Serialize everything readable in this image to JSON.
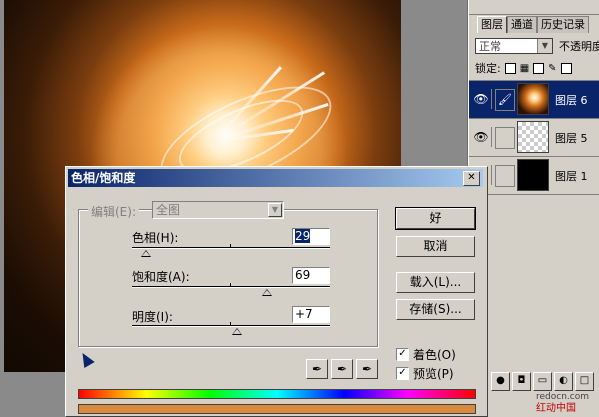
{
  "layers_panel": {
    "tabs": [
      "图层",
      "通道",
      "历史记录"
    ],
    "blend_mode": "正常",
    "opacity_label": "不透明度",
    "lock_label": "锁定:",
    "layers": [
      {
        "name": "图层 6",
        "selected": true
      },
      {
        "name": "图层 5",
        "selected": false
      },
      {
        "name": "图层 1",
        "selected": false
      }
    ]
  },
  "dialog": {
    "title": "色相/饱和度",
    "edit_label": "编辑(E):",
    "edit_value": "全图",
    "hue": {
      "label": "色相(H):",
      "value": "29"
    },
    "saturation": {
      "label": "饱和度(A):",
      "value": "69"
    },
    "lightness": {
      "label": "明度(I):",
      "value": "+7"
    },
    "buttons": {
      "ok": "好",
      "cancel": "取消",
      "load": "载入(L)...",
      "save": "存储(S)..."
    },
    "colorize": {
      "label": "着色(O)",
      "checked": true
    },
    "preview": {
      "label": "预览(P)",
      "checked": true
    }
  },
  "watermark": {
    "url": "redocn.com",
    "text": "红动中国"
  }
}
